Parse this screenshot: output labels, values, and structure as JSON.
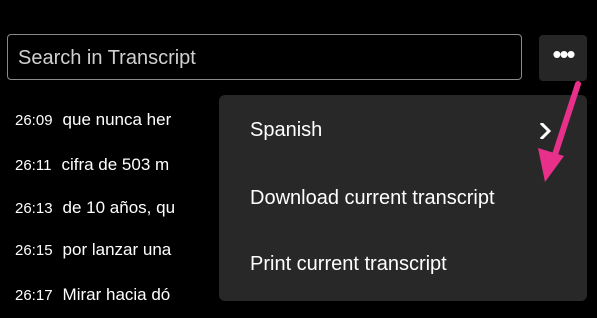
{
  "search": {
    "placeholder": "Search in Transcript"
  },
  "more_button": {
    "label": "•••"
  },
  "transcript": [
    {
      "time": "26:09",
      "text": "que nunca her"
    },
    {
      "time": "26:11",
      "text": "cifra de 503 m"
    },
    {
      "time": "26:13",
      "text": "de 10 años, qu"
    },
    {
      "time": "26:15",
      "text": "por lanzar una"
    },
    {
      "time": "26:17",
      "text": "Mirar hacia dó"
    }
  ],
  "menu": {
    "items": [
      {
        "label": "Spanish",
        "icon": "chevron-right-icon"
      },
      {
        "label": "Download current transcript"
      },
      {
        "label": "Print current transcript"
      }
    ]
  },
  "colors": {
    "background": "#000000",
    "menu_bg": "#282828",
    "arrow": "#e8308a"
  }
}
